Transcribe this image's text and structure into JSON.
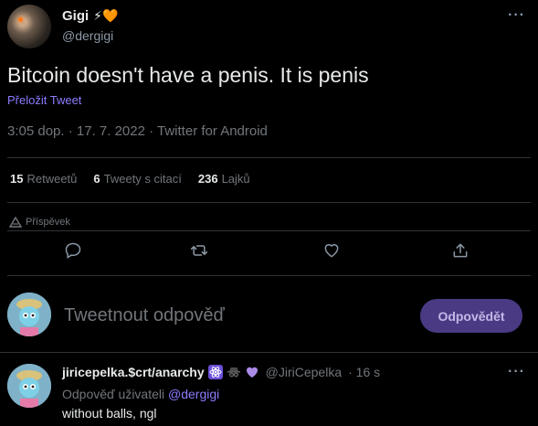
{
  "author": {
    "name": "Gigi",
    "emoji": "⚡🧡",
    "handle": "@dergigi"
  },
  "tweet": {
    "text": "Bitcoin doesn't have a penis. It is penis",
    "translate_label": "Přeložit Tweet",
    "meta": "3:05 dop. · 17. 7. 2022 · Twitter for Android"
  },
  "stats": {
    "retweets_count": "15",
    "retweets_label": "Retweetů",
    "quotes_count": "6",
    "quotes_label": "Tweety s citací",
    "likes_count": "236",
    "likes_label": "Lajků"
  },
  "promo_label": "Příspěvek",
  "reply_box": {
    "placeholder": "Tweetnout odpověď",
    "button_label": "Odpovědět"
  },
  "reply": {
    "name": "jiricepelka.$crt/anarchy",
    "handle": "@JiriCepelka",
    "time": "· 16 s",
    "replying_to_label": "Odpověď uživateli",
    "replying_to_mention": "@dergigi",
    "text": "without balls, ngl"
  },
  "colors": {
    "background": "#000000",
    "accent": "#8a7cff",
    "muted": "#71767b",
    "reply_button_bg": "#4a3a84"
  }
}
